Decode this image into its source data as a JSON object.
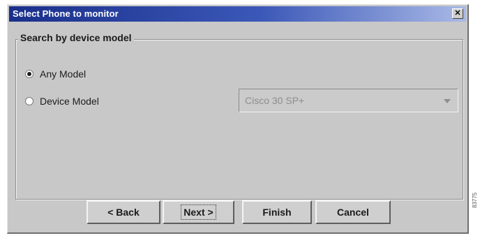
{
  "window": {
    "title": "Select Phone to monitor",
    "close_label": "✕"
  },
  "group": {
    "legend": "Search by device model"
  },
  "options": {
    "any_model": {
      "label": "Any Model",
      "checked": true
    },
    "device_model": {
      "label": "Device Model",
      "checked": false
    }
  },
  "device_select": {
    "value": "Cisco 30 SP+",
    "enabled": false
  },
  "buttons": {
    "back": "< Back",
    "next": "Next >",
    "finish": "Finish",
    "cancel": "Cancel"
  },
  "figure_code": "83775"
}
